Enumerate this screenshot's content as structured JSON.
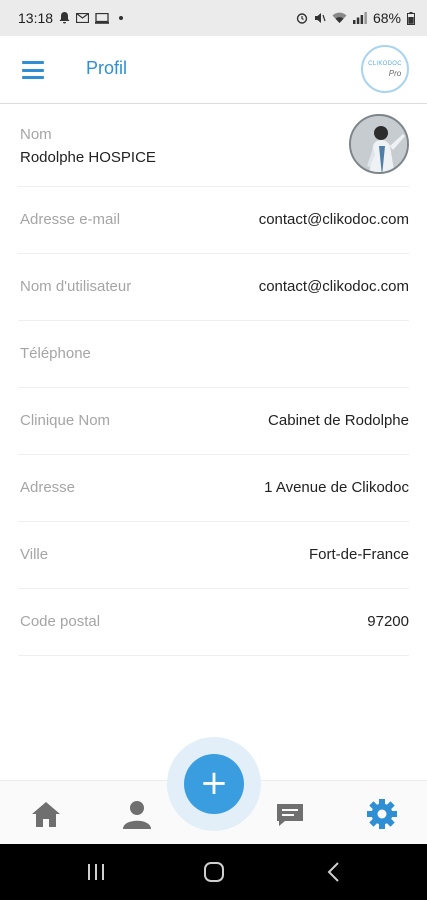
{
  "status_bar": {
    "time": "13:18",
    "battery": "68%",
    "icons": [
      "notification-icon",
      "mail-icon",
      "cast-icon",
      "alarm-icon",
      "mute-icon",
      "wifi-icon",
      "signal-icon",
      "battery-icon"
    ]
  },
  "app_bar": {
    "title": "Profil",
    "logo_text": "CLIKODOC",
    "logo_sub": "Pro"
  },
  "profile": {
    "name_label": "Nom",
    "name_value": "Rodolphe HOSPICE",
    "fields": [
      {
        "label": "Adresse e-mail",
        "value": "contact@clikodoc.com"
      },
      {
        "label": "Nom d'utilisateur",
        "value": "contact@clikodoc.com"
      },
      {
        "label": "Téléphone",
        "value": ""
      },
      {
        "label": "Clinique Nom",
        "value": "Cabinet de Rodolphe"
      },
      {
        "label": "Adresse",
        "value": "1 Avenue de Clikodoc"
      },
      {
        "label": "Ville",
        "value": "Fort-de-France"
      },
      {
        "label": "Code postal",
        "value": "97200"
      }
    ]
  },
  "bottom_nav": {
    "fab_label": "+",
    "items": [
      "home-icon",
      "user-icon",
      "chat-icon",
      "settings-icon"
    ],
    "active_item": "settings-icon"
  },
  "colors": {
    "accent": "#2f8fd4",
    "fab": "#3a9de0",
    "label": "#a5a5a5",
    "inactive_icon": "#6f6f6f"
  }
}
